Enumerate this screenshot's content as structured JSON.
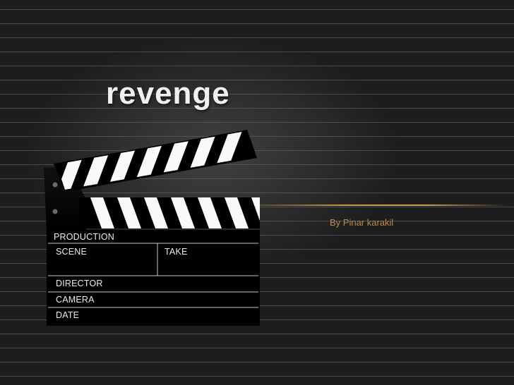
{
  "slide": {
    "title": "revenge",
    "author": "By Pinar karakil"
  },
  "clapperboard": {
    "labels": {
      "production": "PRODUCTION",
      "scene": "SCENE",
      "take": "TAKE",
      "director": "DIRECTOR",
      "camera": "CAMERA",
      "date": "DATE"
    }
  },
  "colors": {
    "title": "#f0f0f0",
    "author": "#c8893a",
    "accent": "#c89840",
    "board": "#000000",
    "stripe": "#ffffff"
  }
}
